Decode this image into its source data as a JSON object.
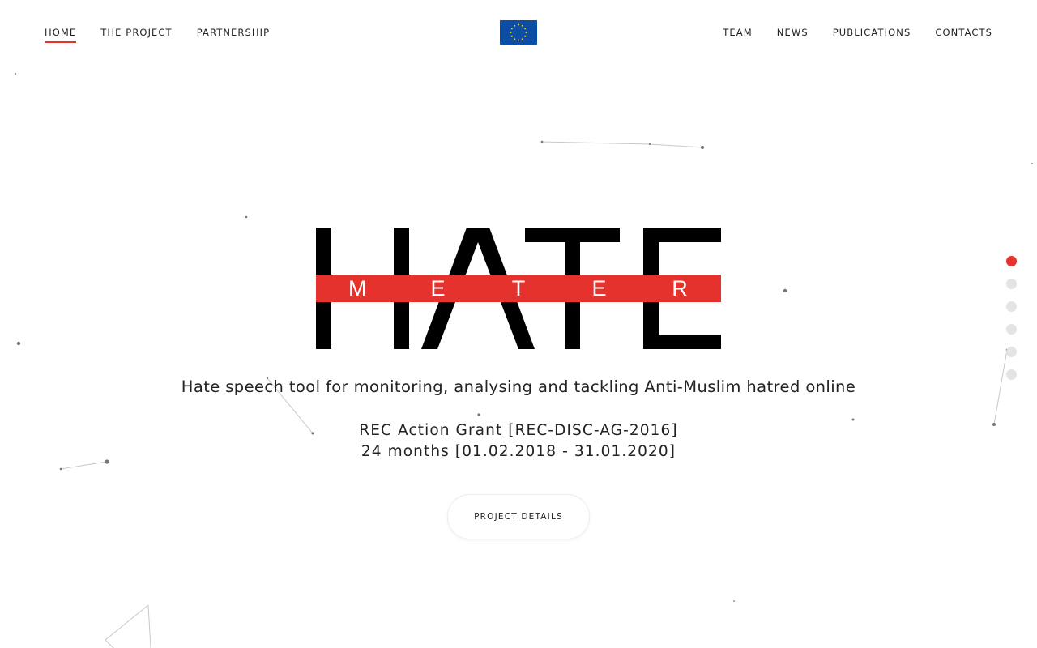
{
  "nav": {
    "left": [
      {
        "label": "HOME",
        "active": true
      },
      {
        "label": "THE PROJECT",
        "active": false
      },
      {
        "label": "PARTNERSHIP",
        "active": false
      }
    ],
    "right": [
      {
        "label": "TEAM"
      },
      {
        "label": "NEWS"
      },
      {
        "label": "PUBLICATIONS"
      },
      {
        "label": "CONTACTS"
      }
    ]
  },
  "logo": {
    "word_main": "HATE",
    "word_sub": [
      "M",
      "E",
      "T",
      "E",
      "R"
    ]
  },
  "hero": {
    "tagline": "Hate speech tool for monitoring, analysing and tackling Anti-Muslim hatred online",
    "grant_line1": "REC Action Grant [REC-DISC-AG-2016]",
    "grant_line2": "24 months [01.02.2018 - 31.01.2020]",
    "button_label": "PROJECT DETAILS"
  },
  "section_nav": {
    "count": 6,
    "active_index": 0
  },
  "colors": {
    "accent": "#e5322d",
    "eu_blue": "#0d4ea5",
    "eu_star": "#ffd617",
    "text": "#222222"
  }
}
